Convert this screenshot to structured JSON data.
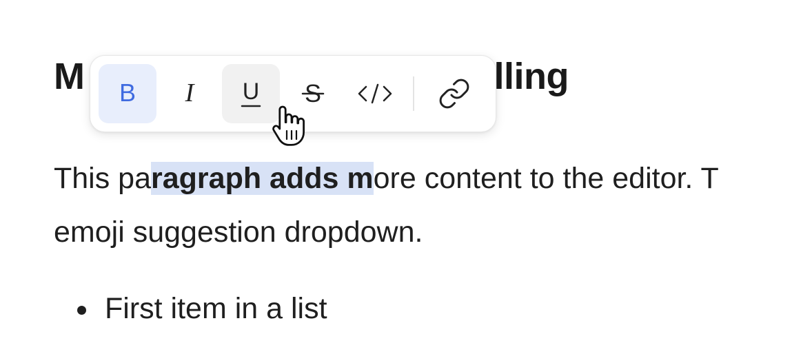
{
  "heading": {
    "text_left": "M",
    "text_right": "lling"
  },
  "paragraph": {
    "line1_before": "This pa",
    "line1_selected": "ragraph adds m",
    "line1_after": "ore content to the editor. T",
    "line2": "emoji suggestion dropdown."
  },
  "list": {
    "items": [
      "First item in a list"
    ]
  },
  "toolbar": {
    "buttons": [
      {
        "name": "bold",
        "icon": "bold-icon",
        "state": "active"
      },
      {
        "name": "italic",
        "icon": "italic-icon",
        "state": "normal"
      },
      {
        "name": "underline",
        "icon": "underline-icon",
        "state": "hover"
      },
      {
        "name": "strikethrough",
        "icon": "strikethrough-icon",
        "state": "normal"
      },
      {
        "name": "code",
        "icon": "code-icon",
        "state": "normal"
      },
      {
        "name": "link",
        "icon": "link-icon",
        "state": "normal"
      }
    ],
    "bold_glyph": "B",
    "italic_glyph": "I",
    "underline_glyph": "U",
    "strike_glyph": "S",
    "code_glyph": "</>"
  },
  "colors": {
    "selection": "#d8e2f6",
    "accent": "#3f6be0",
    "active_bg": "#e8eefc"
  }
}
